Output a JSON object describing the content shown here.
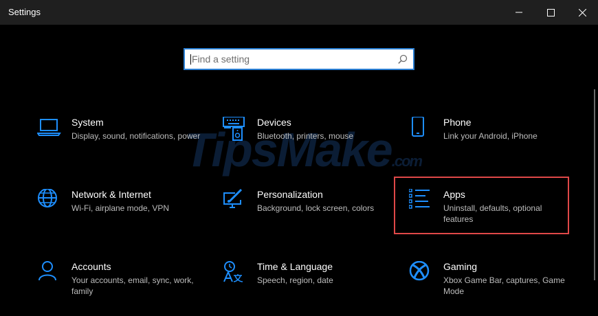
{
  "window": {
    "title": "Settings"
  },
  "search": {
    "placeholder": "Find a setting"
  },
  "watermark": {
    "text": "TipsMake",
    "suffix": ".com"
  },
  "accent_color": "#0078d7",
  "highlight_color": "#e04848",
  "tiles": [
    {
      "name": "System",
      "desc": "Display, sound, notifications, power",
      "icon": "laptop-icon"
    },
    {
      "name": "Devices",
      "desc": "Bluetooth, printers, mouse",
      "icon": "keyboard-speaker-icon"
    },
    {
      "name": "Phone",
      "desc": "Link your Android, iPhone",
      "icon": "phone-icon"
    },
    {
      "name": "Network & Internet",
      "desc": "Wi-Fi, airplane mode, VPN",
      "icon": "globe-icon"
    },
    {
      "name": "Personalization",
      "desc": "Background, lock screen, colors",
      "icon": "monitor-brush-icon"
    },
    {
      "name": "Apps",
      "desc": "Uninstall, defaults, optional features",
      "icon": "apps-list-icon"
    },
    {
      "name": "Accounts",
      "desc": "Your accounts, email, sync, work, family",
      "icon": "person-icon"
    },
    {
      "name": "Time & Language",
      "desc": "Speech, region, date",
      "icon": "time-language-icon"
    },
    {
      "name": "Gaming",
      "desc": "Xbox Game Bar, captures, Game Mode",
      "icon": "xbox-icon"
    }
  ]
}
